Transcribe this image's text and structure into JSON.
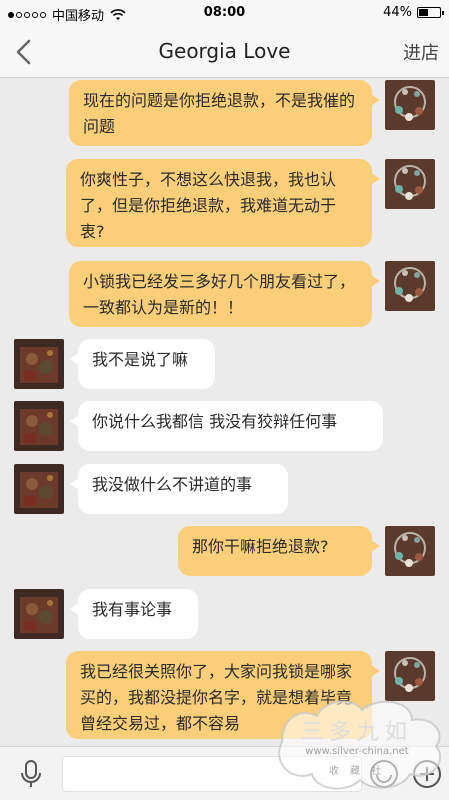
{
  "status_bar": {
    "carrier": "中国移动",
    "time": "08:00",
    "battery": "44%",
    "battery_level": 0.44
  },
  "nav": {
    "title": "Georgia Love",
    "right_button": "进店"
  },
  "messages": [
    {
      "direction": "out",
      "text": "现在的问题是你拒绝退款，不是我催的问题"
    },
    {
      "direction": "out",
      "text": "你爽性子，不想这么快退我，我也认了，但是你拒绝退款，我难道无动于衷?"
    },
    {
      "direction": "out",
      "text": "小锁我已经发三多好几个朋友看过了，一致都认为是新的！！"
    },
    {
      "direction": "in",
      "text": "我不是说了嘛"
    },
    {
      "direction": "in",
      "text": "你说什么我都信 我没有狡辩任何事"
    },
    {
      "direction": "in",
      "text": "我没做什么不讲道的事"
    },
    {
      "direction": "out",
      "text": "那你干嘛拒绝退款?"
    },
    {
      "direction": "in",
      "text": "我有事论事"
    },
    {
      "direction": "out",
      "text": "我已经很关照你了，大家问我锁是哪家买的，我都没提你名字，就是想着毕竟曾经交易过，都不容易"
    }
  ],
  "watermark": {
    "title": "三多九如",
    "url": "www.silver-china.net",
    "sub": "收 藏 社"
  },
  "colors": {
    "outgoing_bubble": "#fbcf7a",
    "incoming_bubble": "#ffffff",
    "background": "#ebebeb"
  }
}
